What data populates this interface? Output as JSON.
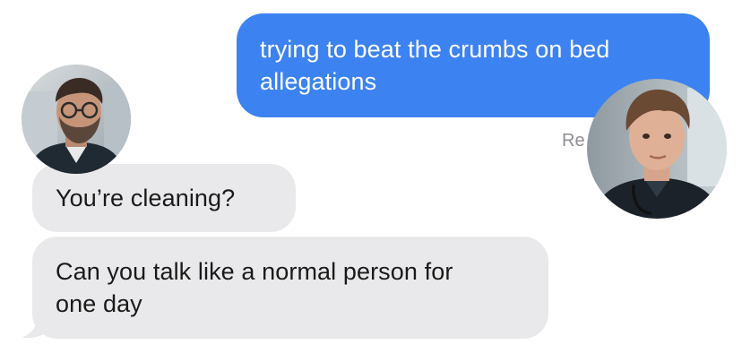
{
  "conversation": {
    "messages": [
      {
        "direction": "sent",
        "lines": [
          "trying to beat the crumbs on bed",
          "allegations"
        ]
      },
      {
        "direction": "received",
        "lines": [
          "You’re cleaning?"
        ]
      },
      {
        "direction": "received",
        "lines": [
          "Can you talk like a normal person for",
          "one day"
        ]
      }
    ],
    "receipt_partial": "Re"
  },
  "colors": {
    "sent_bubble": "#3c82f0",
    "received_bubble": "#e9e9eb",
    "receipt_text": "#8e8e93"
  }
}
